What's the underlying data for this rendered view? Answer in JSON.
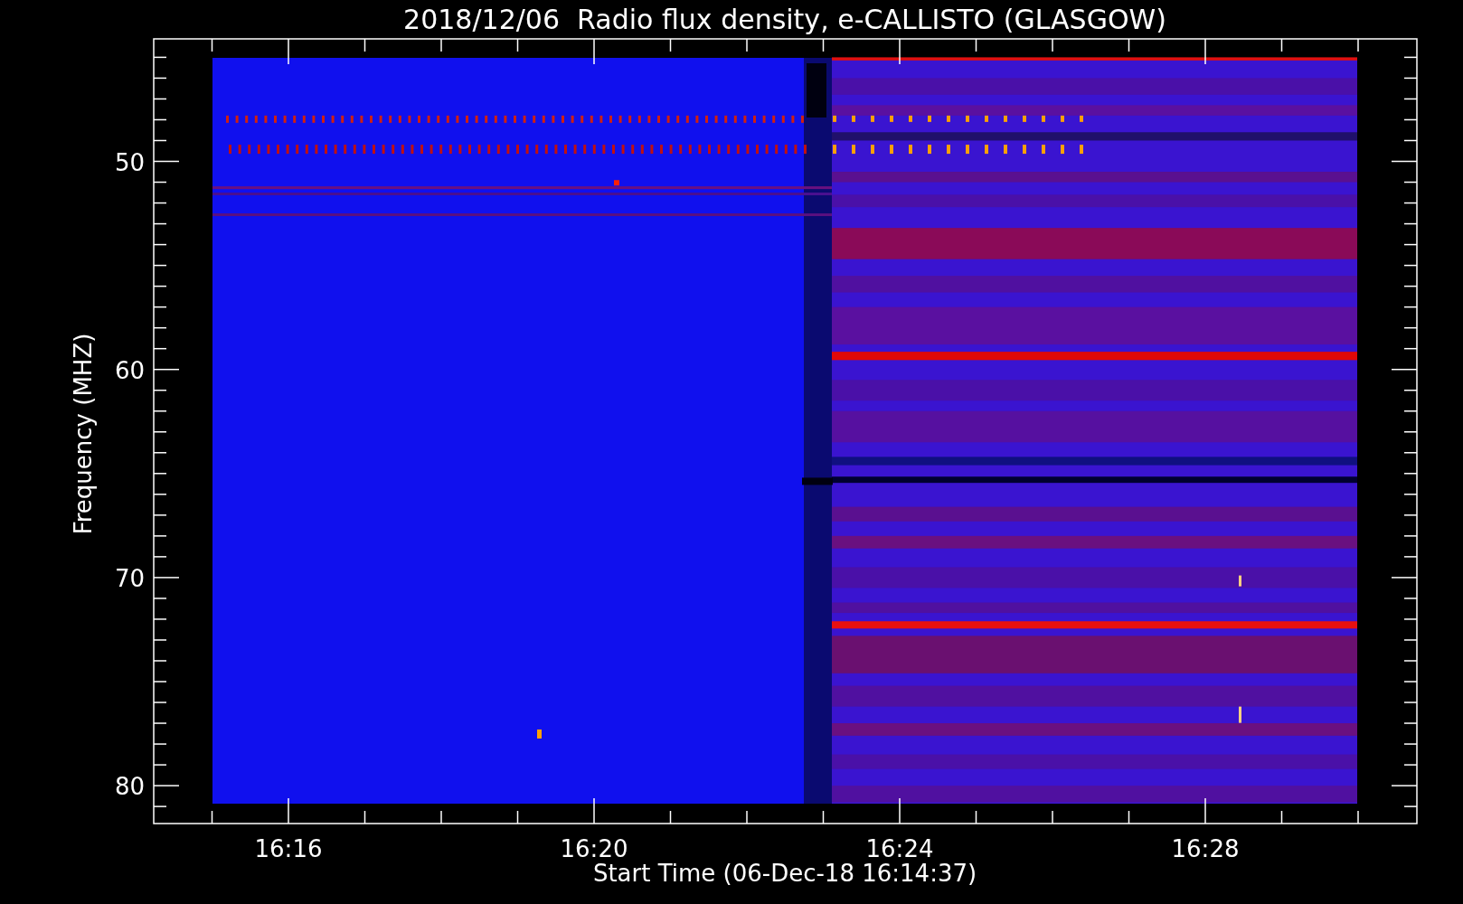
{
  "title": "2018/12/06  Radio flux density, e-CALLISTO (GLASGOW)",
  "y_axis": {
    "label": "Frequency (MHZ)",
    "ticks": [
      "50",
      "60",
      "70",
      "80"
    ]
  },
  "x_axis": {
    "label": "Start Time (06-Dec-18 16:14:37)",
    "ticks": [
      "16:16",
      "16:20",
      "16:24",
      "16:28"
    ]
  }
}
